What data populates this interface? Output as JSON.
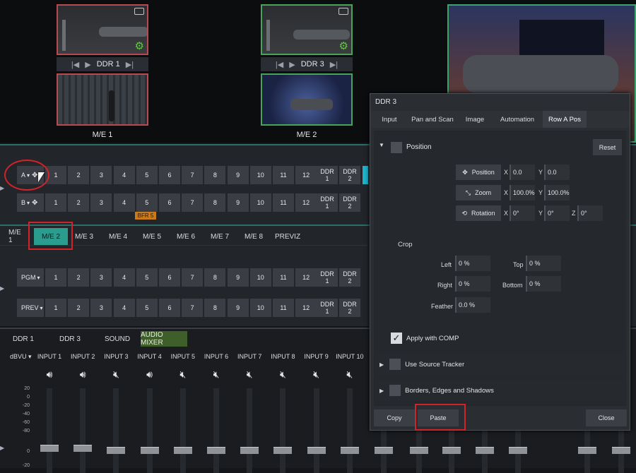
{
  "top_monitors": {
    "ddr1_label": "DDR 1",
    "ddr3_label": "DDR 3",
    "me1_label": "M/E 1",
    "me2_label": "M/E 2"
  },
  "row_a": {
    "label": "A",
    "buttons": [
      "1",
      "2",
      "3",
      "4",
      "5",
      "6",
      "7",
      "8",
      "9",
      "10",
      "11",
      "12"
    ],
    "ddr_buttons": [
      "DDR 1",
      "DDR 2"
    ]
  },
  "row_b": {
    "label": "B",
    "buttons": [
      "1",
      "2",
      "3",
      "4",
      "5",
      "6",
      "7",
      "8",
      "9",
      "10",
      "11",
      "12"
    ],
    "ddr_buttons": [
      "DDR 1",
      "DDR 2"
    ],
    "tag": "BFR 5"
  },
  "me_tabs": [
    "M/E 1",
    "M/E 2",
    "M/E 3",
    "M/E 4",
    "M/E 5",
    "M/E 6",
    "M/E 7",
    "M/E 8",
    "PREVIZ"
  ],
  "pgm_row": {
    "label": "PGM",
    "buttons": [
      "1",
      "2",
      "3",
      "4",
      "5",
      "6",
      "7",
      "8",
      "9",
      "10",
      "11",
      "12"
    ],
    "ddr_buttons": [
      "DDR 1",
      "DDR 2"
    ]
  },
  "prev_row": {
    "label": "PREV",
    "buttons": [
      "1",
      "2",
      "3",
      "4",
      "5",
      "6",
      "7",
      "8",
      "9",
      "10",
      "11",
      "12"
    ],
    "ddr_buttons": [
      "DDR 1",
      "DDR 2"
    ]
  },
  "bottom_tabs": [
    "DDR 1",
    "DDR 3",
    "SOUND",
    "AUDIO MIXER"
  ],
  "mixer": {
    "unit": "dBVU",
    "inputs": [
      "INPUT 1",
      "INPUT 2",
      "INPUT 3",
      "INPUT 4",
      "INPUT 5",
      "INPUT 6",
      "INPUT 7",
      "INPUT 8",
      "INPUT 9",
      "INPUT 10"
    ],
    "scale": [
      "20",
      "0",
      "-20",
      "-40",
      "-60",
      "-80"
    ],
    "zero_label": "0",
    "bottom_label": "-20"
  },
  "dialog": {
    "title": "DDR 3",
    "tabs": [
      "Input",
      "Pan and Scan",
      "Image",
      "Automation",
      "Row A Pos"
    ],
    "position_header": "Position",
    "reset_label": "Reset",
    "position_btn": "Position",
    "zoom_btn": "Zoom",
    "rotation_btn": "Rotation",
    "x_label": "X",
    "y_label": "Y",
    "z_label": "Z",
    "pos_x": "0.0",
    "pos_y": "0.0",
    "zoom_x": "100.0%",
    "zoom_y": "100.0%",
    "rot_x": "0°",
    "rot_y": "0°",
    "rot_z": "0°",
    "crop_label": "Crop",
    "left_label": "Left",
    "left_value": "0 %",
    "top_label": "Top",
    "top_value": "0 %",
    "right_label": "Right",
    "right_value": "0 %",
    "bottom_label": "Bottom",
    "bottom_value": "0 %",
    "feather_label": "Feather",
    "feather_value": "0.0 %",
    "apply_comp": "Apply with COMP",
    "use_source_tracker": "Use Source Tracker",
    "borders": "Borders, Edges and Shadows",
    "copy_label": "Copy",
    "paste_label": "Paste",
    "close_label": "Close"
  },
  "colors": {
    "accent_teal": "#2a9d8f",
    "audio_green": "#3f5f2a",
    "red_highlight": "#d0232a",
    "bfr_orange": "#c97a1c"
  }
}
